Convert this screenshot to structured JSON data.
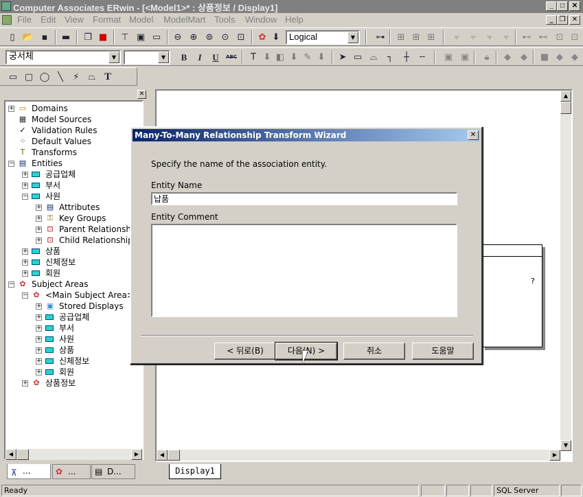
{
  "window": {
    "title": "Computer Associates ERwin - [<Model1>* : 상품정보 / Display1]",
    "min_glyph": "_",
    "max_glyph": "□",
    "close_glyph": "✕",
    "restore_glyph": "❐"
  },
  "menu": [
    "File",
    "Edit",
    "View",
    "Format",
    "Model",
    "ModelMart",
    "Tools",
    "Window",
    "Help"
  ],
  "toolbar1": {
    "view_select": "Logical"
  },
  "toolbar2": {
    "font_select": "궁서체",
    "size_select": "",
    "bold": "B",
    "italic": "I",
    "underline": "U",
    "strike": "ABC"
  },
  "toolbar3": {
    "text_tool": "T"
  },
  "tree": [
    {
      "label": "Domains",
      "indent": 0,
      "expander": "+",
      "icon": "folder-icon"
    },
    {
      "label": "Model Sources",
      "indent": 0,
      "expander": "",
      "icon": "model-sources-icon"
    },
    {
      "label": "Validation Rules",
      "indent": 0,
      "expander": "",
      "icon": "validation-icon"
    },
    {
      "label": "Default Values",
      "indent": 0,
      "expander": "",
      "icon": "default-values-icon"
    },
    {
      "label": "Transforms",
      "indent": 0,
      "expander": "",
      "icon": "transform-icon"
    },
    {
      "label": "Entities",
      "indent": 0,
      "expander": "−",
      "icon": "entities-icon"
    },
    {
      "label": "공급업체",
      "indent": 1,
      "expander": "+",
      "icon": "entity-icon"
    },
    {
      "label": "부서",
      "indent": 1,
      "expander": "+",
      "icon": "entity-icon"
    },
    {
      "label": "사원",
      "indent": 1,
      "expander": "−",
      "icon": "entity-icon"
    },
    {
      "label": "Attributes",
      "indent": 2,
      "expander": "+",
      "icon": "attributes-icon"
    },
    {
      "label": "Key Groups",
      "indent": 2,
      "expander": "+",
      "icon": "key-icon"
    },
    {
      "label": "Parent Relationsh",
      "indent": 2,
      "expander": "+",
      "icon": "relationship-icon"
    },
    {
      "label": "Child Relationship",
      "indent": 2,
      "expander": "+",
      "icon": "relationship-icon"
    },
    {
      "label": "상품",
      "indent": 1,
      "expander": "+",
      "icon": "entity-icon"
    },
    {
      "label": "신체정보",
      "indent": 1,
      "expander": "+",
      "icon": "entity-icon"
    },
    {
      "label": "회원",
      "indent": 1,
      "expander": "+",
      "icon": "entity-icon"
    },
    {
      "label": "Subject Areas",
      "indent": 0,
      "expander": "−",
      "icon": "subject-area-icon"
    },
    {
      "label": "<Main Subject Area>",
      "indent": 1,
      "expander": "−",
      "icon": "subject-area-icon"
    },
    {
      "label": "Stored Displays",
      "indent": 2,
      "expander": "+",
      "icon": "stored-displays-icon"
    },
    {
      "label": "공급업체",
      "indent": 2,
      "expander": "+",
      "icon": "entity-icon"
    },
    {
      "label": "부서",
      "indent": 2,
      "expander": "+",
      "icon": "entity-icon"
    },
    {
      "label": "사원",
      "indent": 2,
      "expander": "+",
      "icon": "entity-icon"
    },
    {
      "label": "상품",
      "indent": 2,
      "expander": "+",
      "icon": "entity-icon"
    },
    {
      "label": "신체정보",
      "indent": 2,
      "expander": "+",
      "icon": "entity-icon"
    },
    {
      "label": "회원",
      "indent": 2,
      "expander": "+",
      "icon": "entity-icon"
    },
    {
      "label": "상품정보",
      "indent": 1,
      "expander": "+",
      "icon": "subject-area-icon"
    }
  ],
  "left_tabs": [
    "...",
    "...",
    "D..."
  ],
  "sheet_tab": "Display1",
  "status": {
    "text": "Ready",
    "db": "SQL Server"
  },
  "dialog": {
    "title": "Many-To-Many Relationship Transform Wizard",
    "instruction": "Specify the name of the association entity.",
    "entity_name_label": "Entity Name",
    "entity_name_value": "납품",
    "entity_comment_label": "Entity Comment",
    "entity_comment_value": "",
    "back_button": "< 뒤로(B)",
    "next_button": "다음(N) >",
    "cancel_button": "취소",
    "help_button": "도움말"
  }
}
